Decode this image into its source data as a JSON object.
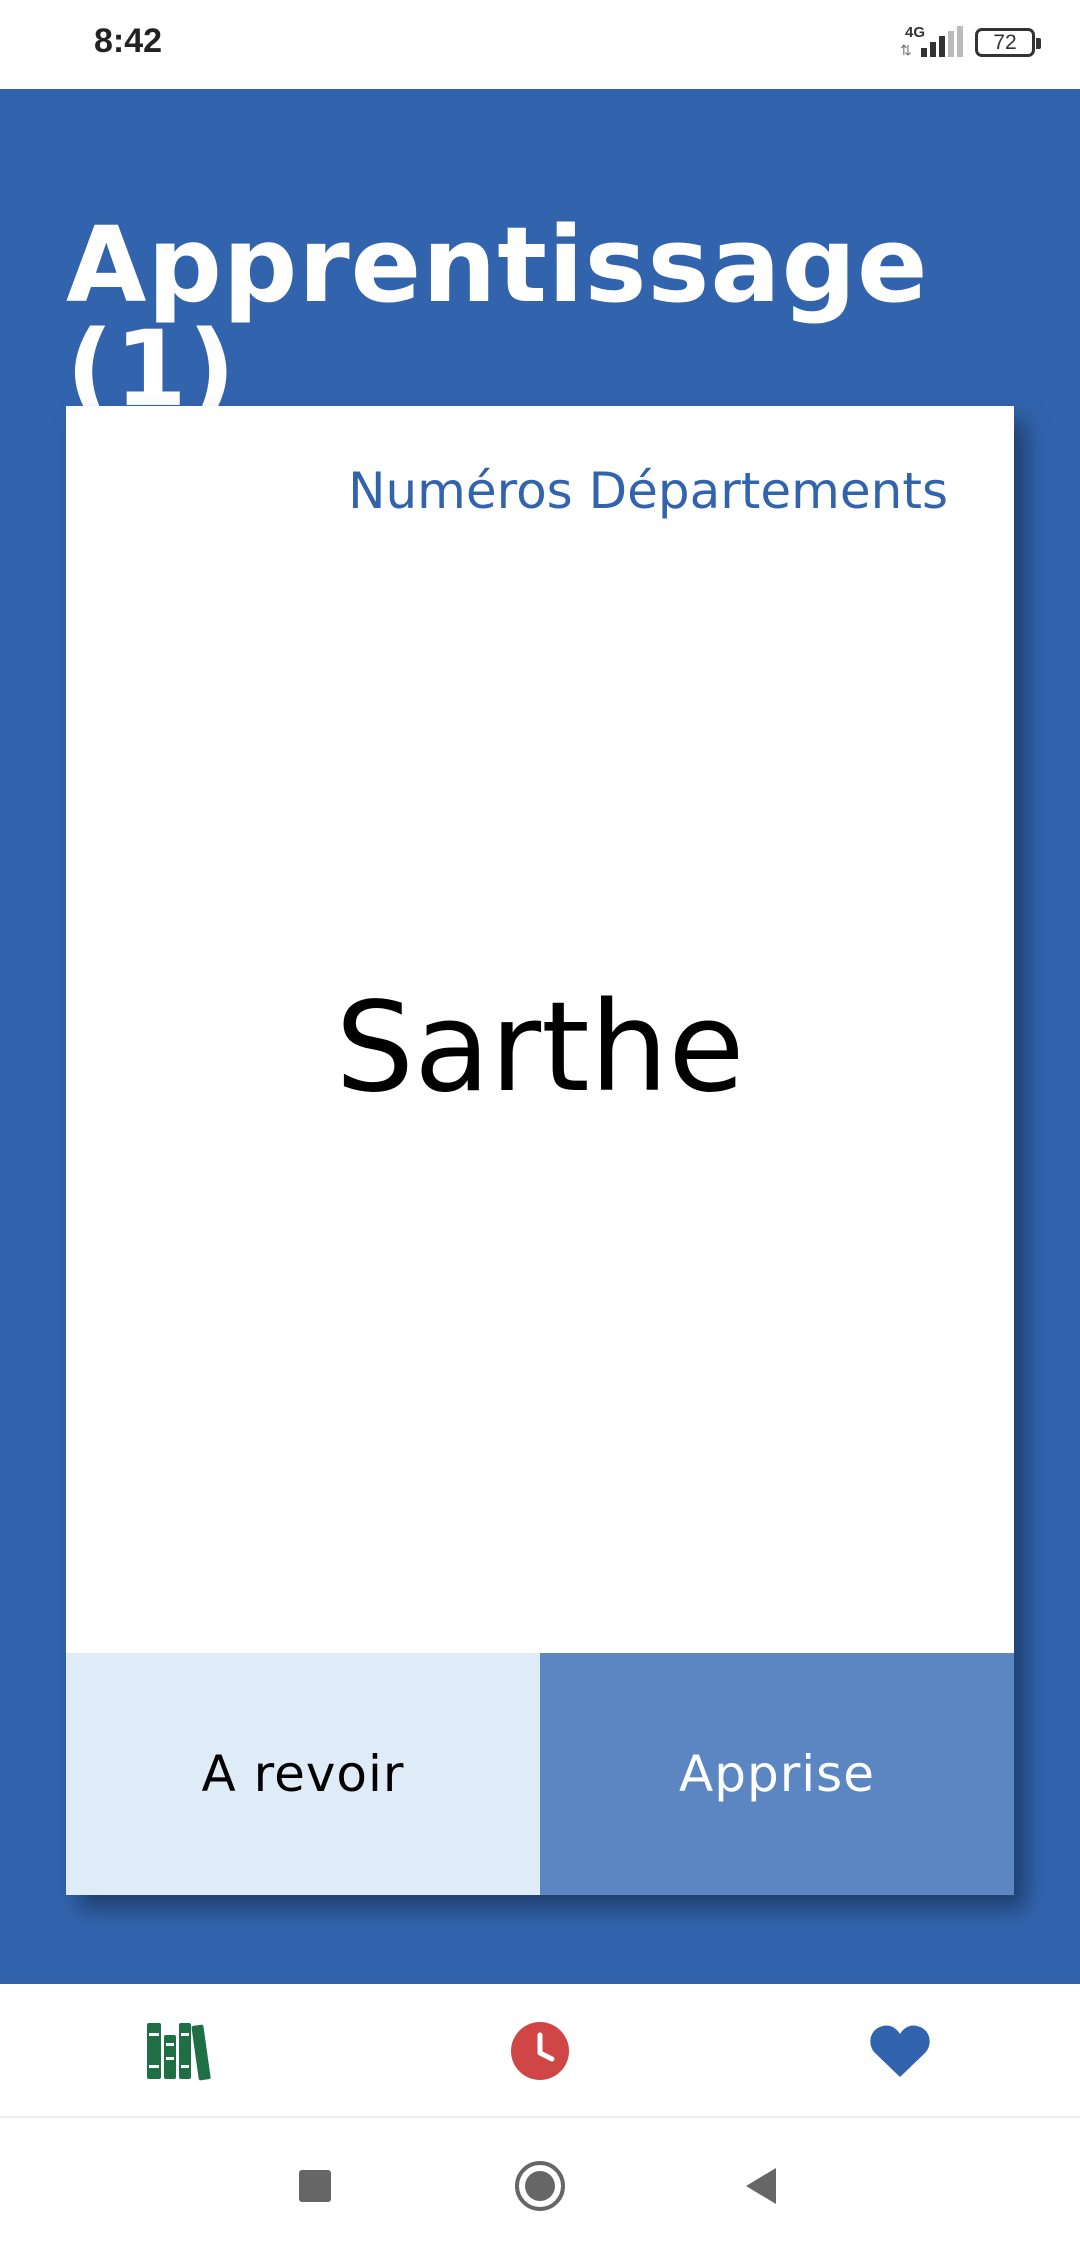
{
  "status_bar": {
    "time": "8:42",
    "network": "4G",
    "data_arrows": "⇅",
    "battery": "72"
  },
  "page": {
    "title": "Apprentissage (1)"
  },
  "card": {
    "category": "Numéros Départements",
    "term": "Sarthe",
    "actions": {
      "review_label": "A revoir",
      "learned_label": "Apprise"
    }
  },
  "bottom_nav": {
    "items": [
      {
        "icon": "books-icon",
        "color": "#1e7044"
      },
      {
        "icon": "clock-icon",
        "color": "#d04545"
      },
      {
        "icon": "heart-icon",
        "color": "#3264ae"
      }
    ]
  },
  "system_nav": {
    "buttons": [
      "recents-icon",
      "home-icon",
      "back-icon"
    ]
  },
  "colors": {
    "primary": "#3264ae",
    "review_button": "#dfecf8",
    "learned_button": "#5c86c1"
  }
}
